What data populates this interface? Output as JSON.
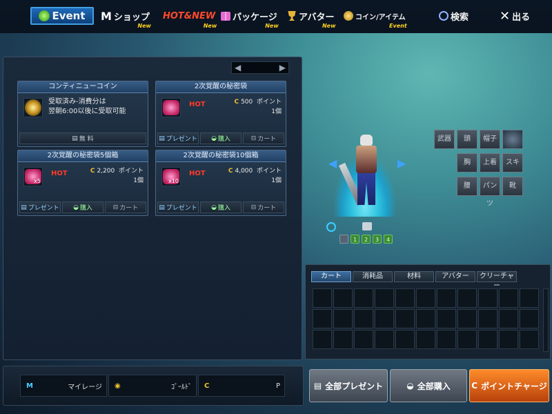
{
  "nav": {
    "event": "Event",
    "shop": "ショップ",
    "shop_sub": "New",
    "hotnew": "HOT&NEW",
    "hotnew_sub": "New",
    "package": "パッケージ",
    "package_sub": "New",
    "avatar": "アバター",
    "avatar_sub": "New",
    "coin_item": "コイン/アイテム",
    "coin_item_sub": "Event",
    "search": "検索",
    "exit": "出る"
  },
  "pager": {
    "prev": "◀",
    "next": "▶"
  },
  "items": [
    {
      "title": "コンティニューコイン",
      "desc1": "受取済み-消費分は",
      "desc2": "翌朝6:00以後に受取可能",
      "free": "無 料"
    },
    {
      "title": "2次覚醒の秘密袋",
      "hot": "HOT",
      "price": "500",
      "unit": "ポイント",
      "qty": "1個",
      "qty_badge": "",
      "gift": "プレゼント",
      "buy": "購入",
      "cart": "カート"
    },
    {
      "title": "2次覚醒の秘密袋5個箱",
      "hot": "HOT",
      "price": "2,200",
      "unit": "ポイント",
      "qty": "1個",
      "qty_badge": "x5",
      "gift": "プレゼント",
      "buy": "購入",
      "cart": "カート"
    },
    {
      "title": "2次覚醒の秘密袋10個箱",
      "hot": "HOT",
      "price": "4,000",
      "unit": "ポイント",
      "qty": "1個",
      "qty_badge": "x10",
      "gift": "プレゼント",
      "buy": "購入",
      "cart": "カート"
    }
  ],
  "equipment": {
    "weapon": "武器",
    "head": "頭",
    "hat": "帽子",
    "chest": "胸",
    "top": "上着",
    "skin": "スキン",
    "waist": "腰",
    "pants": "パンツ",
    "shoes": "靴"
  },
  "slots": [
    "1",
    "2",
    "3",
    "4"
  ],
  "cart_tabs": [
    "カート",
    "消耗品",
    "材料",
    "アバター",
    "クリーチャー"
  ],
  "balances": {
    "mileage": "マイレージ",
    "gold": "ｺﾞｰﾙﾄﾞ",
    "points": "P"
  },
  "buttons": {
    "gift_all": "全部プレゼント",
    "buy_all": "全部購入",
    "charge": "ポイントチャージ"
  },
  "colors": {
    "accent": "#43a0e6",
    "hot": "#ff3a2a",
    "charge": "#ff8b2a"
  }
}
